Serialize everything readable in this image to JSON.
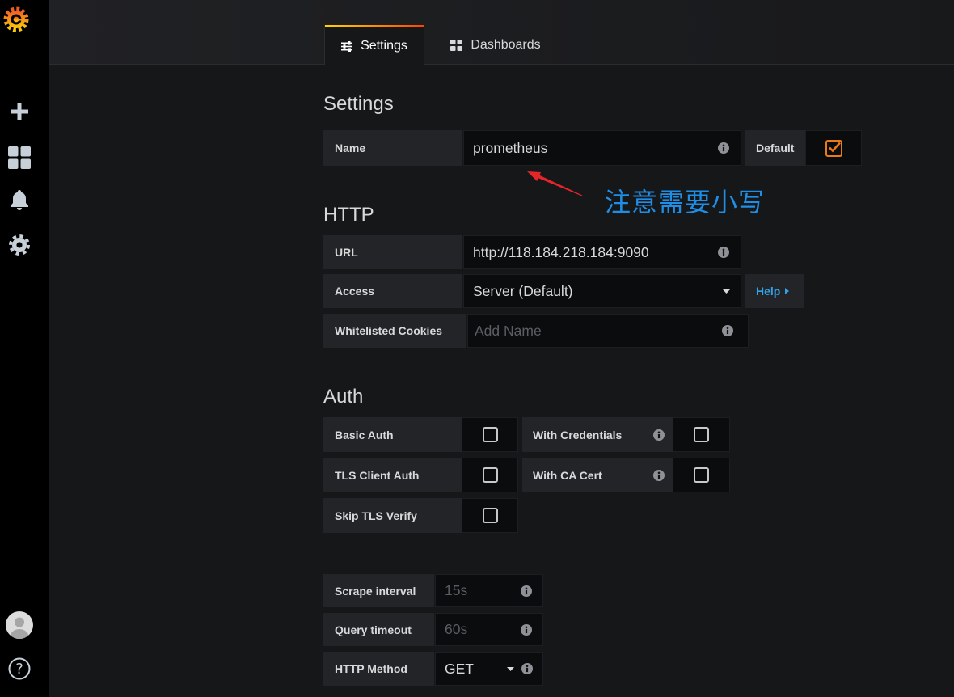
{
  "sidebar": {
    "logo_icon": "grafana-logo-icon",
    "nav": [
      {
        "icon": "plus-icon"
      },
      {
        "icon": "dashboards-icon"
      },
      {
        "icon": "bell-icon"
      },
      {
        "icon": "gear-icon"
      }
    ],
    "profile_icon": "avatar",
    "help_icon": "help-icon",
    "help_glyph": "?"
  },
  "tabs": [
    {
      "label": "Settings",
      "icon": "sliders-icon",
      "active": true
    },
    {
      "label": "Dashboards",
      "icon": "grid-icon",
      "active": false
    }
  ],
  "settings": {
    "heading": "Settings",
    "name": {
      "label": "Name",
      "value": "prometheus"
    },
    "default": {
      "label": "Default",
      "checked": true
    }
  },
  "annotation": {
    "text": "注意需要小写"
  },
  "http": {
    "heading": "HTTP",
    "url": {
      "label": "URL",
      "value": "http://118.184.218.184:9090"
    },
    "access": {
      "label": "Access",
      "value": "Server (Default)"
    },
    "help": {
      "label": "Help"
    },
    "cookies": {
      "label": "Whitelisted Cookies",
      "placeholder": "Add Name"
    }
  },
  "auth": {
    "heading": "Auth",
    "basic_auth": {
      "label": "Basic Auth",
      "checked": false
    },
    "with_credentials": {
      "label": "With Credentials",
      "checked": false
    },
    "tls_client_auth": {
      "label": "TLS Client Auth",
      "checked": false
    },
    "with_ca_cert": {
      "label": "With CA Cert",
      "checked": false
    },
    "skip_tls_verify": {
      "label": "Skip TLS Verify",
      "checked": false
    }
  },
  "prometheus": {
    "scrape_interval": {
      "label": "Scrape interval",
      "placeholder": "15s"
    },
    "query_timeout": {
      "label": "Query timeout",
      "placeholder": "60s"
    },
    "http_method": {
      "label": "HTTP Method",
      "value": "GET"
    }
  },
  "colors": {
    "accent": "#eb7b18",
    "link": "#33a2e5",
    "tab_gradient_start": "#ffd500",
    "tab_gradient_end": "#ff4400",
    "annotation_text": "#1e8fe8",
    "annotation_arrow": "#e4252a"
  }
}
